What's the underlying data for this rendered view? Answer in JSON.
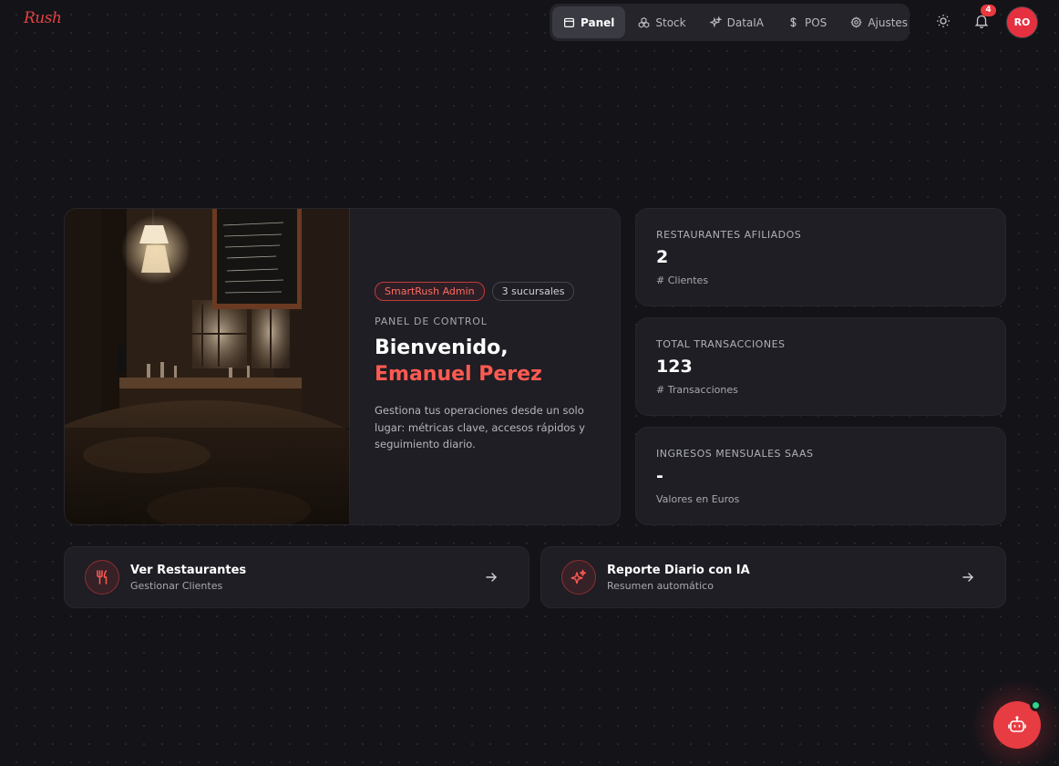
{
  "brand": {
    "logo_text": "Rush",
    "accent": "#e8393f"
  },
  "nav": {
    "items": [
      {
        "label": "Panel",
        "icon": "calendar-icon",
        "active": true
      },
      {
        "label": "Stock",
        "icon": "boxes-icon",
        "active": false
      },
      {
        "label": "DataIA",
        "icon": "sparkles-icon",
        "active": false
      },
      {
        "label": "POS",
        "icon": "dollar-icon",
        "active": false
      },
      {
        "label": "Ajustes",
        "icon": "gear-icon",
        "active": false
      }
    ]
  },
  "topbar": {
    "notifications_count": "4",
    "avatar_initials": "RO"
  },
  "hero": {
    "pill_role": "SmartRush Admin",
    "pill_branches": "3 sucursales",
    "eyebrow": "PANEL DE CONTROL",
    "greeting": "Bienvenido,",
    "name": "Emanuel Perez",
    "description": "Gestiona tus operaciones desde un solo lugar: métricas clave, accesos rápidos y seguimiento diario."
  },
  "stats": [
    {
      "label": "RESTAURANTES AFILIADOS",
      "value": "2",
      "sub": "# Clientes"
    },
    {
      "label": "TOTAL TRANSACCIONES",
      "value": "123",
      "sub": "# Transacciones"
    },
    {
      "label": "INGRESOS MENSUALES SAAS",
      "value": "-",
      "sub": "Valores en Euros"
    }
  ],
  "actions": [
    {
      "title": "Ver Restaurantes",
      "subtitle": "Gestionar Clientes",
      "icon": "utensils-icon"
    },
    {
      "title": "Reporte Diario con IA",
      "subtitle": "Resumen automático",
      "icon": "sparkles-icon"
    }
  ],
  "assistant": {
    "icon": "bot-icon",
    "status_color": "#2fd48a"
  }
}
